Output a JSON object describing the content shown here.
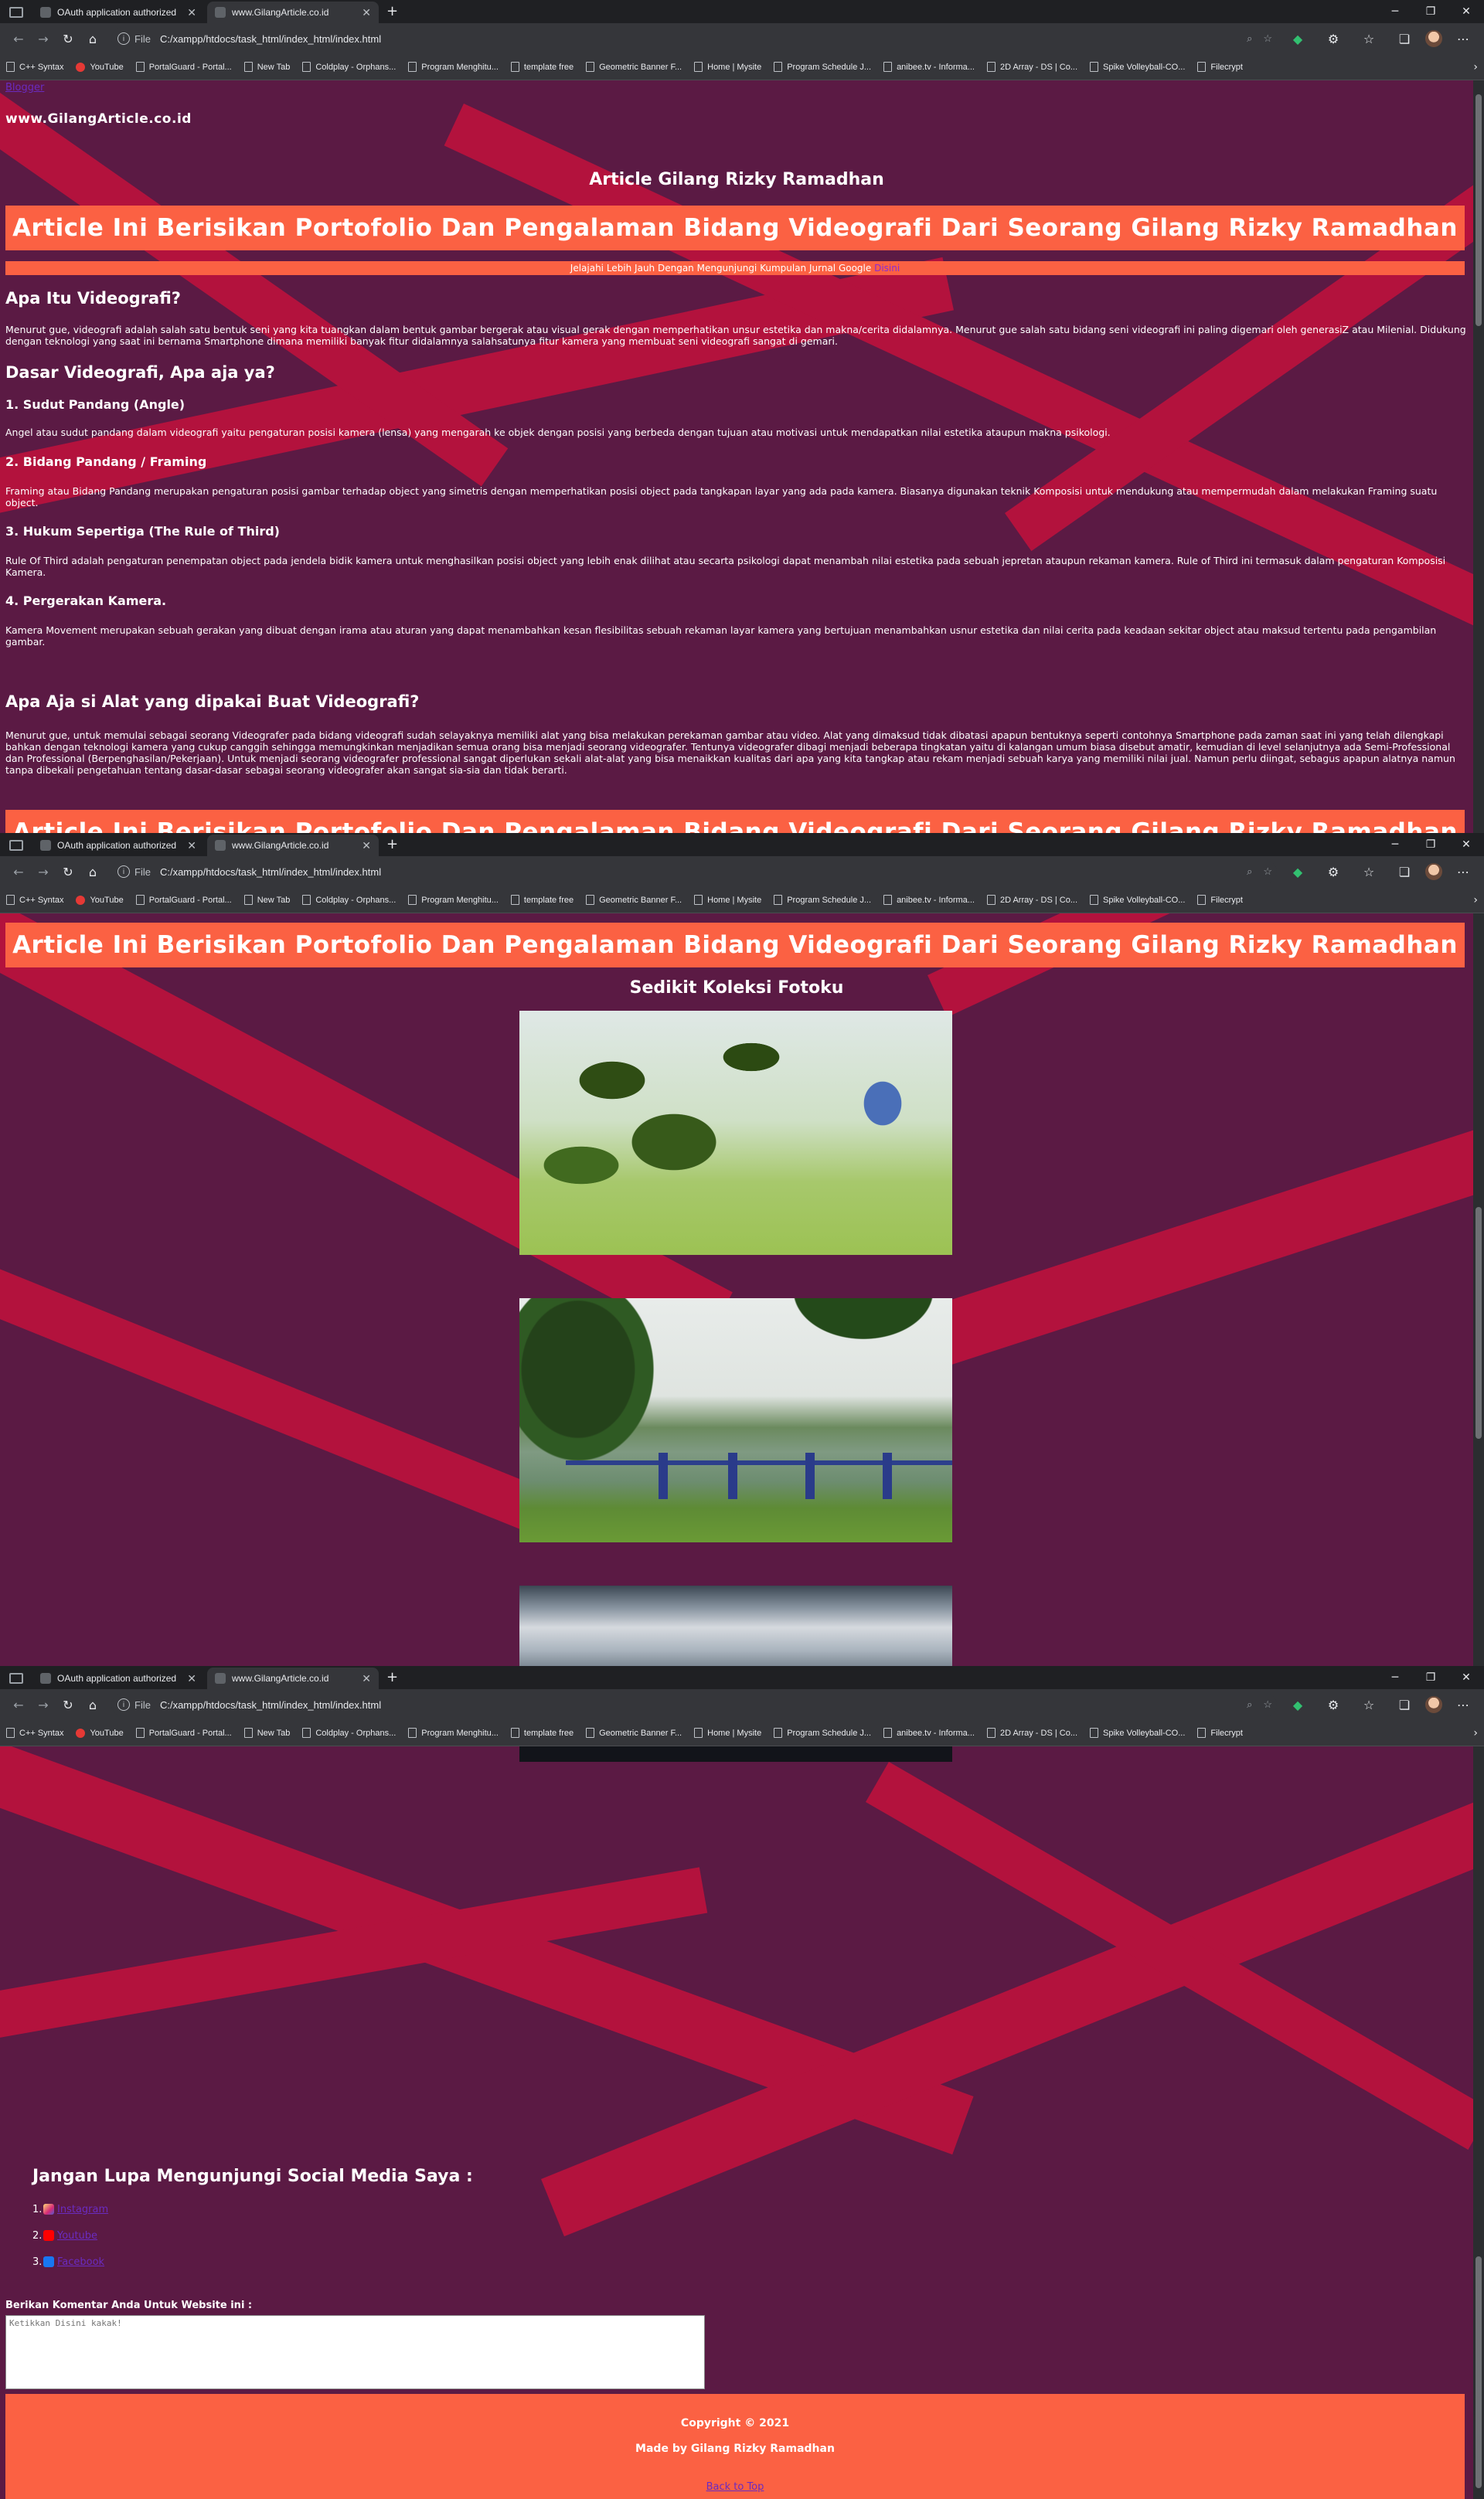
{
  "browser": {
    "tabs": [
      {
        "title": "OAuth application authorized",
        "active": false
      },
      {
        "title": "www.GilangArticle.co.id",
        "active": true
      }
    ],
    "url_scheme": "File",
    "url": "C:/xampp/htdocs/task_html/index_html/index.html",
    "bookmarks": [
      "C++ Syntax",
      "YouTube",
      "PortalGuard - Portal...",
      "New Tab",
      "Coldplay - Orphans...",
      "Program Menghitu...",
      "template free",
      "Geometric Banner F...",
      "Home | Mysite",
      "Program Schedule J...",
      "anibee.tv - Informa...",
      "2D Array - DS | Co...",
      "Spike Volleyball-CO...",
      "Filecrypt"
    ]
  },
  "colors": {
    "background": "#5b1a44",
    "stripe": "#b3123d",
    "accent": "#fb6143",
    "link": "#6a2bc0"
  },
  "header": {
    "top_link": "Blogger",
    "site_name": "www.GilangArticle.co.id",
    "article_title": "Article Gilang Rizky Ramadhan",
    "banner": "Article Ini Berisikan Portofolio Dan Pengalaman Bidang Videografi Dari Seorang Gilang Rizky Ramadhan",
    "sub_banner_text": "Jelajahi Lebih Jauh Dengan Mengunjungi Kumpulan Jurnal Google ",
    "sub_banner_link": "Disini"
  },
  "article": {
    "h1": "Apa Itu Videografi?",
    "p1": "Menurut gue, videografi adalah salah satu bentuk seni yang kita tuangkan dalam bentuk gambar bergerak atau visual gerak dengan memperhatikan unsur estetika dan makna/cerita didalamnya. Menurut gue salah satu bidang seni videografi ini paling digemari oleh generasiZ atau Milenial. Didukung dengan teknologi yang saat ini bernama Smartphone dimana memiliki banyak fitur didalamnya salahsatunya fitur kamera yang membuat seni videografi sangat di gemari.",
    "h2": "Dasar Videografi, Apa aja ya?",
    "s1_title": "1. Sudut Pandang (Angle)",
    "s1_text": "Angel atau sudut pandang dalam videografi yaitu pengaturan posisi kamera (lensa) yang mengarah ke objek dengan posisi yang berbeda dengan tujuan atau motivasi untuk mendapatkan nilai estetika ataupun makna psikologi.",
    "s2_title": "2. Bidang Pandang / Framing",
    "s2_text": "Framing atau Bidang Pandang merupakan pengaturan posisi gambar terhadap object yang simetris dengan memperhatikan posisi object pada tangkapan layar yang ada pada kamera. Biasanya digunakan teknik Komposisi untuk mendukung atau mempermudah dalam melakukan Framing suatu object.",
    "s3_title": "3. Hukum Sepertiga (The Rule of Third)",
    "s3_text": "Rule Of Third adalah pengaturan penempatan object pada jendela bidik kamera untuk menghasilkan posisi object yang lebih enak dilihat atau secarta psikologi dapat menambah nilai estetika pada sebuah jepretan ataupun rekaman kamera. Rule of Third ini termasuk dalam pengaturan Komposisi Kamera.",
    "s4_title": "4. Pergerakan Kamera.",
    "s4_text": "Kamera Movement merupakan sebuah gerakan yang dibuat dengan irama atau aturan yang dapat menambahkan kesan flesibilitas sebuah rekaman layar kamera yang bertujuan menambahkan usnur estetika dan nilai cerita pada keadaan sekitar object atau maksud tertentu pada pengambilan gambar.",
    "h3": "Apa Aja si Alat yang dipakai Buat Videografi?",
    "p3": "Menurut gue, untuk memulai sebagai seorang Videografer pada bidang videografi sudah selayaknya memiliki alat yang bisa melakukan perekaman gambar atau video. Alat yang dimaksud tidak dibatasi apapun bentuknya seperti contohnya Smartphone pada zaman saat ini yang telah dilengkapi bahkan dengan teknologi kamera yang cukup canggih sehingga memungkinkan menjadikan semua orang bisa menjadi seorang videografer. Tentunya videografer dibagi menjadi beberapa tingkatan yaitu di kalangan umum biasa disebut amatir, kemudian di level selanjutnya ada Semi-Professional dan Professional (Berpenghasilan/Pekerjaan). Untuk menjadi seorang videografer professional sangat diperlukan sekali alat-alat yang bisa menaikkan kualitas dari apa yang kita tangkap atau rekam menjadi sebuah karya yang memiliki nilai jual. Namun perlu diingat, sebagus apapun alatnya namun tanpa dibekali pengetahuan tentang dasar-dasar sebagai seorang videografer akan sangat sia-sia dan tidak berarti."
  },
  "gallery": {
    "title": "Sedikit Koleksi Fotoku"
  },
  "social": {
    "heading": "Jangan Lupa Mengunjungi Social Media Saya :",
    "items": [
      {
        "num": "1.",
        "label": "Instagram"
      },
      {
        "num": "2.",
        "label": "Youtube"
      },
      {
        "num": "3.",
        "label": "Facebook"
      }
    ]
  },
  "comment": {
    "label": "Berikan Komentar Anda Untuk Website ini :",
    "placeholder": "Ketikkan Disini kakak!"
  },
  "footer": {
    "copyright": "Copyright © 2021",
    "made_by": "Made by Gilang Rizky Ramadhan",
    "back_to_top": "Back to Top"
  }
}
